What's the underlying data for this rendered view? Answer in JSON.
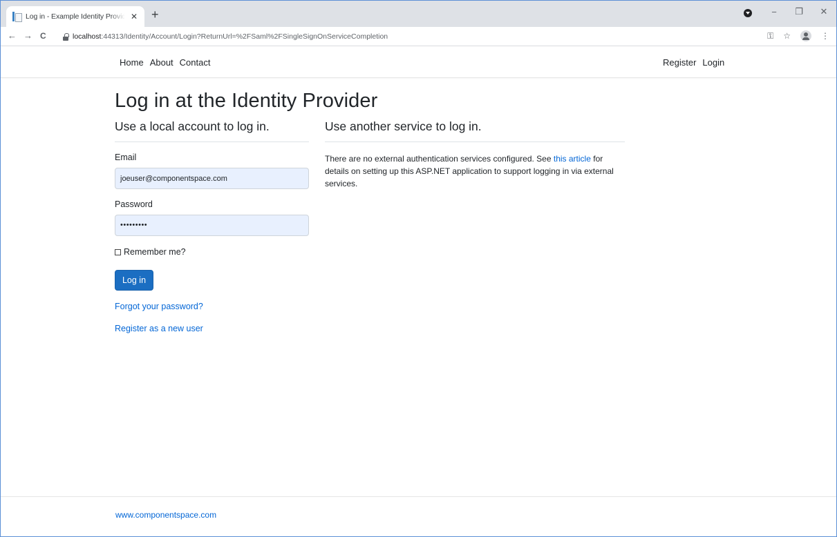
{
  "browser": {
    "tab_title": "Log in - Example Identity Provider",
    "tab_close": "✕",
    "new_tab": "+",
    "url_host": "localhost",
    "url_path": ":44313/Identity/Account/Login?ReturnUrl=%2FSaml%2FSingleSignOnServiceCompletion",
    "back": "←",
    "forward": "→",
    "reload": "C",
    "key_icon": "⚿",
    "star_icon": "☆",
    "menu_icon": "⋮",
    "minimize": "−",
    "restore": "❐",
    "close": "✕"
  },
  "nav": {
    "left": [
      "Home",
      "About",
      "Contact"
    ],
    "right": [
      "Register",
      "Login"
    ]
  },
  "page": {
    "title": "Log in at the Identity Provider",
    "local_heading": "Use a local account to log in.",
    "email_label": "Email",
    "email_value": "joeuser@componentspace.com",
    "password_label": "Password",
    "password_value": "•••••••••",
    "remember_label": "Remember me?",
    "login_button": "Log in",
    "forgot_link": "Forgot your password?",
    "register_link": "Register as a new user",
    "external_heading": "Use another service to log in.",
    "external_text_before": "There are no external authentication services configured. See ",
    "external_link": "this article",
    "external_text_after": " for details on setting up this ASP.NET application to support logging in via external services."
  },
  "footer": {
    "link": "www.componentspace.com"
  },
  "colors": {
    "primary_button": "#1b6ec2",
    "link": "#0366d6",
    "autofill_input": "#e8f0fe",
    "tabstrip": "#dee1e6"
  }
}
